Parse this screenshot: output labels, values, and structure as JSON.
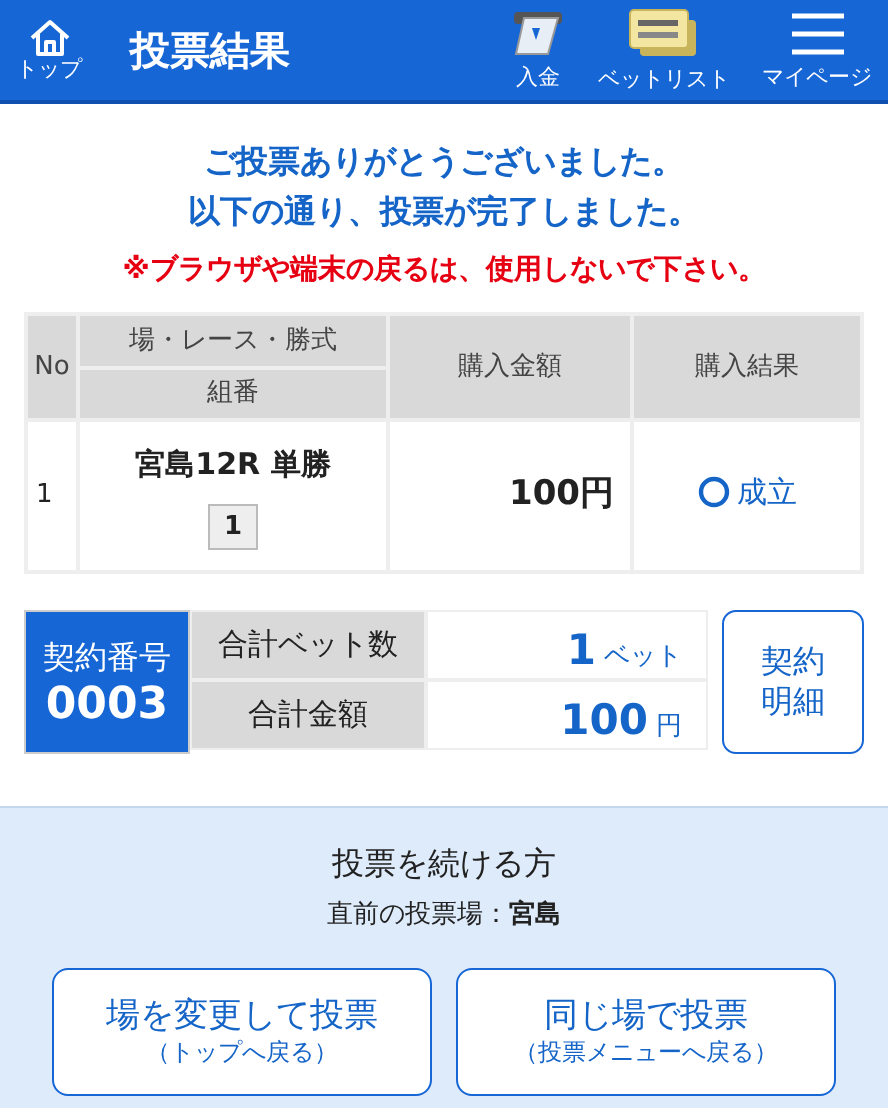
{
  "header": {
    "home": {
      "label": "トップ"
    },
    "title": "投票結果",
    "nav_items": [
      {
        "kind": "deposit",
        "label": "入金"
      },
      {
        "kind": "betlist",
        "label": "ベットリスト"
      },
      {
        "kind": "menu",
        "label": "マイページ"
      }
    ]
  },
  "messages": [
    {
      "kind": "info",
      "text": "ご投票ありがとうございました。"
    },
    {
      "kind": "info",
      "text": "以下の通り、投票が完了しました。"
    },
    {
      "kind": "warning",
      "text": "※ブラウザや端末の戻るは、使用しないで下さい。"
    }
  ],
  "table": {
    "columns": {
      "no": "No",
      "race": "場・レース・勝式",
      "combination": "組番",
      "amount": "購入金額",
      "result": "購入結果"
    },
    "rows": [
      {
        "no": "1",
        "race": "宮島12R 単勝",
        "combination": "1",
        "amount": "100円",
        "result": "成立",
        "success": true
      }
    ]
  },
  "contract": {
    "label": "契約番号",
    "number": "0003",
    "rows": [
      {
        "label": "合計ベット数",
        "value": "1",
        "unit": "ベット"
      },
      {
        "label": "合計金額",
        "value": "100",
        "unit": "円"
      }
    ],
    "details_button": [
      "契約",
      "明細"
    ]
  },
  "continue": {
    "title": "投票を続ける方",
    "previous": "直前の投票場：**宮島**",
    "buttons": [
      {
        "label": "場を変更して投票",
        "sub": "（トップへ戻る）"
      },
      {
        "label": "同じ場で投票",
        "sub": "（投票メニューへ戻る）"
      }
    ]
  }
}
